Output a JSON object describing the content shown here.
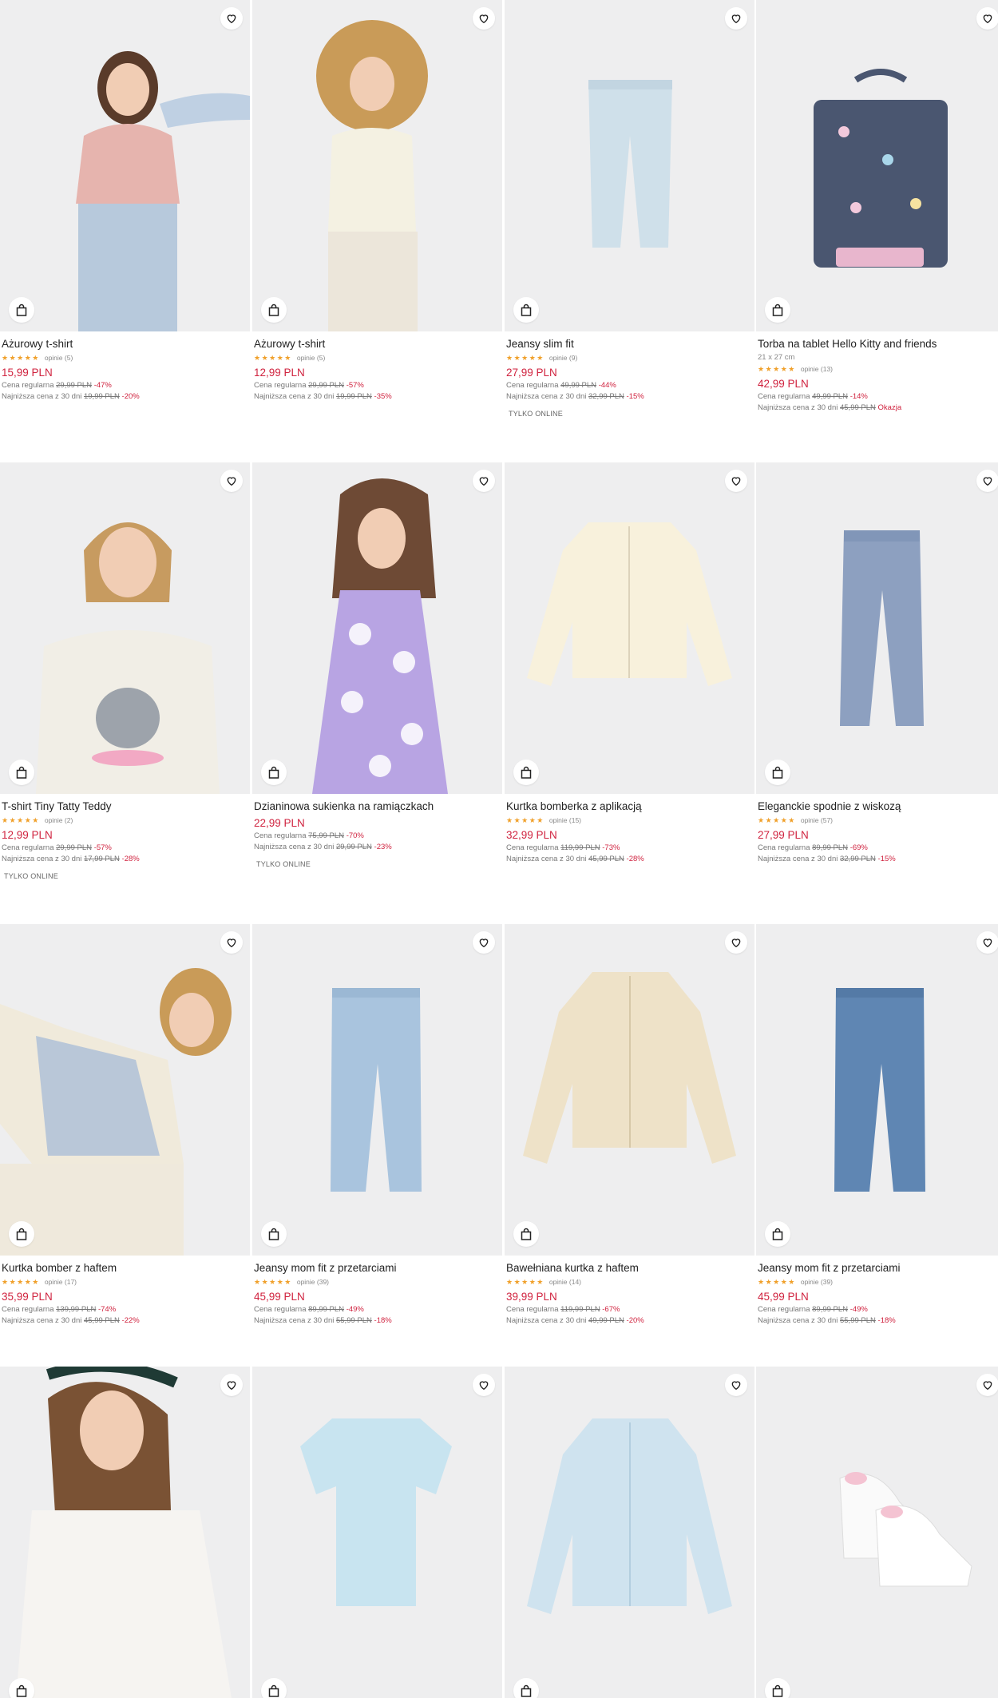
{
  "colors": {
    "sale": "#d0233f",
    "stars": "#f0a02a",
    "image_bg": "#eeeeef"
  },
  "products": [
    {
      "title": "Ażurowy t-shirt",
      "stars": "★★★★★",
      "reviews": "opinie (5)",
      "price": "15,99 PLN",
      "regular_label": "Cena regularna",
      "regular_price": "29,99 PLN",
      "regular_pct": "-47%",
      "lowest_label": "Najniższa cena z 30 dni",
      "lowest_price": "19,99 PLN",
      "lowest_pct": "-20%",
      "icon": "girl-pink-tshirt"
    },
    {
      "title": "Ażurowy t-shirt",
      "stars": "★★★★★",
      "reviews": "opinie (5)",
      "price": "12,99 PLN",
      "regular_label": "Cena regularna",
      "regular_price": "29,99 PLN",
      "regular_pct": "-57%",
      "lowest_label": "Najniższa cena z 30 dni",
      "lowest_price": "19,99 PLN",
      "lowest_pct": "-35%",
      "icon": "girl-cream-tshirt"
    },
    {
      "title": "Jeansy slim fit",
      "stars": "★★★★★",
      "reviews": "opinie (9)",
      "price": "27,99 PLN",
      "regular_label": "Cena regularna",
      "regular_price": "49,99 PLN",
      "regular_pct": "-44%",
      "lowest_label": "Najniższa cena z 30 dni",
      "lowest_price": "32,99 PLN",
      "lowest_pct": "-15%",
      "badge": "TYLKO ONLINE",
      "icon": "light-jeans"
    },
    {
      "title": "Torba na tablet Hello Kitty and friends",
      "subtitle": "21 x 27 cm",
      "stars": "★★★★★",
      "reviews": "opinie (13)",
      "price": "42,99 PLN",
      "regular_label": "Cena regularna",
      "regular_price": "49,99 PLN",
      "regular_pct": "-14%",
      "lowest_label": "Najniższa cena z 30 dni",
      "lowest_price": "45,99 PLN",
      "lowest_pct": "Okazja",
      "icon": "tablet-bag"
    },
    {
      "title": "T-shirt Tiny Tatty Teddy",
      "stars": "★★★★★",
      "reviews": "opinie (2)",
      "price": "12,99 PLN",
      "regular_label": "Cena regularna",
      "regular_price": "29,99 PLN",
      "regular_pct": "-57%",
      "lowest_label": "Najniższa cena z 30 dni",
      "lowest_price": "17,99 PLN",
      "lowest_pct": "-28%",
      "badge": "TYLKO ONLINE",
      "icon": "girl-teddy-tshirt"
    },
    {
      "title": "Dzianinowa sukienka na ramiączkach",
      "price": "22,99 PLN",
      "regular_label": "Cena regularna",
      "regular_price": "75,99 PLN",
      "regular_pct": "-70%",
      "lowest_label": "Najniższa cena z 30 dni",
      "lowest_price": "29,99 PLN",
      "lowest_pct": "-23%",
      "badge": "TYLKO ONLINE",
      "icon": "girl-flower-dress"
    },
    {
      "title": "Kurtka bomberka z aplikacją",
      "stars": "★★★★★",
      "reviews": "opinie (15)",
      "price": "32,99 PLN",
      "regular_label": "Cena regularna",
      "regular_price": "119,99 PLN",
      "regular_pct": "-73%",
      "lowest_label": "Najniższa cena z 30 dni",
      "lowest_price": "45,99 PLN",
      "lowest_pct": "-28%",
      "icon": "cream-bomber"
    },
    {
      "title": "Eleganckie spodnie z wiskozą",
      "stars": "★★★★★",
      "reviews": "opinie (57)",
      "price": "27,99 PLN",
      "regular_label": "Cena regularna",
      "regular_price": "89,99 PLN",
      "regular_pct": "-69%",
      "lowest_label": "Najniższa cena z 30 dni",
      "lowest_price": "32,99 PLN",
      "lowest_pct": "-15%",
      "icon": "blue-trousers"
    },
    {
      "title": "Kurtka bomber z haftem",
      "stars": "★★★★★",
      "reviews": "opinie (17)",
      "price": "35,99 PLN",
      "regular_label": "Cena regularna",
      "regular_price": "139,99 PLN",
      "regular_pct": "-74%",
      "lowest_label": "Najniższa cena z 30 dni",
      "lowest_price": "45,99 PLN",
      "lowest_pct": "-22%",
      "icon": "girl-bomber"
    },
    {
      "title": "Jeansy mom fit z przetarciami",
      "stars": "★★★★★",
      "reviews": "opinie (39)",
      "price": "45,99 PLN",
      "regular_label": "Cena regularna",
      "regular_price": "89,99 PLN",
      "regular_pct": "-49%",
      "lowest_label": "Najniższa cena z 30 dni",
      "lowest_price": "55,99 PLN",
      "lowest_pct": "-18%",
      "icon": "light-mom-jeans"
    },
    {
      "title": "Bawełniana kurtka z haftem",
      "stars": "★★★★★",
      "reviews": "opinie (14)",
      "price": "39,99 PLN",
      "regular_label": "Cena regularna",
      "regular_price": "119,99 PLN",
      "regular_pct": "-67%",
      "lowest_label": "Najniższa cena z 30 dni",
      "lowest_price": "49,99 PLN",
      "lowest_pct": "-20%",
      "icon": "beige-jacket"
    },
    {
      "title": "Jeansy mom fit z przetarciami",
      "stars": "★★★★★",
      "reviews": "opinie (39)",
      "price": "45,99 PLN",
      "regular_label": "Cena regularna",
      "regular_price": "89,99 PLN",
      "regular_pct": "-49%",
      "lowest_label": "Najniższa cena z 30 dni",
      "lowest_price": "55,99 PLN",
      "lowest_pct": "-18%",
      "icon": "mid-mom-jeans"
    },
    {
      "icon": "girl-tulle-top"
    },
    {
      "icon": "blue-top"
    },
    {
      "icon": "light-blue-jacket"
    },
    {
      "icon": "white-sneakers"
    }
  ]
}
